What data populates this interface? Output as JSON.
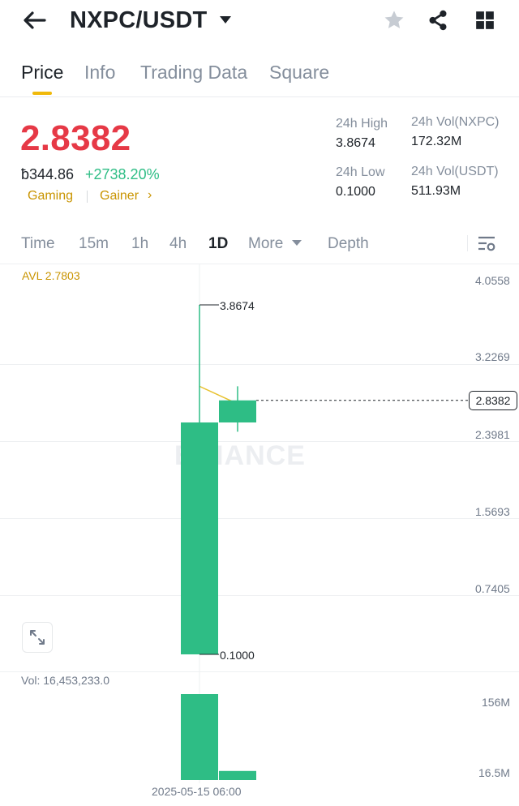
{
  "header": {
    "title": "NXPC/USDT",
    "icons": [
      "back-arrow-icon",
      "caret-down-icon",
      "star-icon",
      "share-icon",
      "grid-icon"
    ]
  },
  "tabs": [
    {
      "label": "Price",
      "active": true
    },
    {
      "label": "Info",
      "active": false
    },
    {
      "label": "Trading Data",
      "active": false
    },
    {
      "label": "Square",
      "active": false
    }
  ],
  "price": {
    "last": "2.8382",
    "fiat": "ƀ344.86",
    "change": "+2738.20%",
    "tags": [
      "Gaming",
      "Gainer"
    ],
    "tag_arrow": "›"
  },
  "stats": {
    "high_label": "24h High",
    "high_value": "3.8674",
    "low_label": "24h Low",
    "low_value": "0.1000",
    "vol_base_label": "24h Vol(NXPC)",
    "vol_base_value": "172.32M",
    "vol_quote_label": "24h Vol(USDT)",
    "vol_quote_value": "511.93M"
  },
  "intervals": {
    "time": "Time",
    "i15m": "15m",
    "i1h": "1h",
    "i4h": "4h",
    "i1d": "1D",
    "more": "More",
    "depth": "Depth",
    "active": "1D"
  },
  "colors": {
    "up": "#2ebd85",
    "down": "#e63946",
    "accent": "#f0b90b",
    "avl_line": "#e8c12e"
  },
  "chart_data": {
    "type": "candlestick",
    "watermark": "BINANCE",
    "avl_label": "AVL 2.7803",
    "current_price_label": "2.8382",
    "y_axis_ticks": [
      "4.0558",
      "3.2269",
      "2.3981",
      "1.5693",
      "0.7405"
    ],
    "ylim": [
      0.1,
      4.0558
    ],
    "high_label": "3.8674",
    "low_label": "0.1000",
    "candles": [
      {
        "open": 0.1,
        "close": 2.6,
        "high": 3.8674,
        "low": 0.1,
        "volume": 156
      },
      {
        "open": 2.6,
        "close": 2.8382,
        "high": 2.99,
        "low": 2.5,
        "volume": 16.5
      }
    ],
    "avl_segment": [
      2.99,
      2.8
    ],
    "volume": {
      "label": "Vol: 16,453,233.0",
      "axis_ticks": [
        "156M",
        "16.5M"
      ]
    },
    "x_label": "2025-05-15 06:00"
  }
}
